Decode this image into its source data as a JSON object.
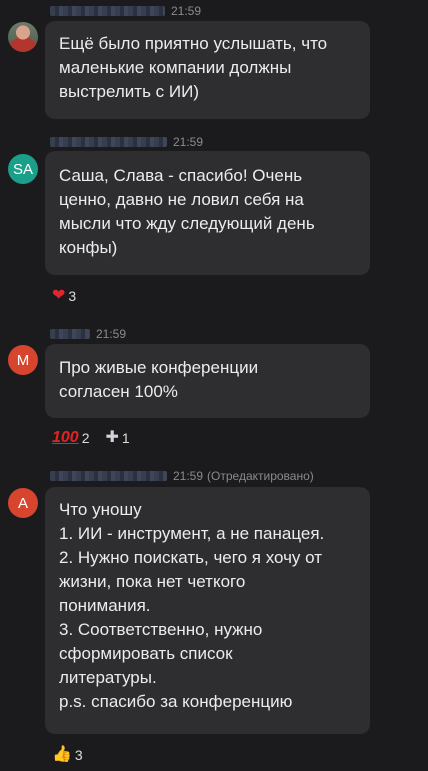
{
  "messages": [
    {
      "avatar_initials": "",
      "avatar_color": "#b2362e",
      "time": "21:59",
      "edited": "",
      "lines": [
        "Ещё было приятно услышать, что",
        "маленькие компании должны",
        "выстрелить с ИИ)"
      ],
      "reactions": []
    },
    {
      "avatar_initials": "SA",
      "avatar_color": "#1aa08a",
      "time": "21:59",
      "edited": "",
      "lines": [
        "Саша, Слава - спасибо! Очень",
        "ценно, давно не ловил себя на",
        "мысли что жду следующий день",
        "конфы)"
      ],
      "reactions": [
        {
          "icon": "heart-icon",
          "emoji": "❤",
          "count": "3"
        }
      ]
    },
    {
      "avatar_initials": "M",
      "avatar_color": "#d7452f",
      "time": "21:59",
      "edited": "",
      "lines": [
        "Про живые конференции",
        "согласен 100%"
      ],
      "reactions": [
        {
          "icon": "hundred-points-icon",
          "emoji": "100",
          "count": "2"
        },
        {
          "icon": "plus-icon",
          "emoji": "✚",
          "count": "1"
        }
      ]
    },
    {
      "avatar_initials": "A",
      "avatar_color": "#d7452f",
      "time": "21:59",
      "edited": "(Отредактировано)",
      "lines": [
        "Что уношу",
        "1. ИИ - инструмент, а не панацея.",
        "2. Нужно поискать, чего я хочу от",
        "жизни, пока нет четкого",
        "понимания.",
        "3. Соответственно, нужно",
        "сформировать список",
        "литературы.",
        "p.s. спасибо за конференцию"
      ],
      "reactions": [
        {
          "icon": "thumbs-up-icon",
          "emoji": "👍",
          "count": "3"
        }
      ]
    }
  ]
}
